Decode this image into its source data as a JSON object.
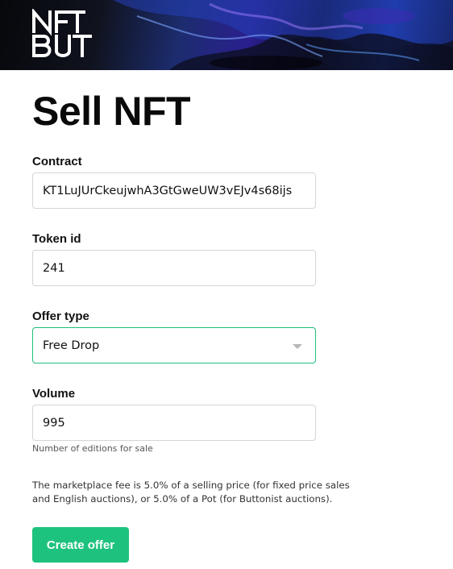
{
  "header": {
    "logo_icon": "nftbutton-logo-icon"
  },
  "page": {
    "title": "Sell NFT"
  },
  "form": {
    "contract": {
      "label": "Contract",
      "value": "KT1LuJUrCkeujwhA3GtGweUW3vEJv4s68ijs"
    },
    "token_id": {
      "label": "Token id",
      "value": "241"
    },
    "offer_type": {
      "label": "Offer type",
      "selected": "Free Drop",
      "icon": "chevron-down-icon"
    },
    "volume": {
      "label": "Volume",
      "value": "995",
      "hint": "Number of editions for sale"
    },
    "fee_line_1": "The marketplace fee is 5.0% of a selling price (for fixed price sales",
    "fee_line_2": "and English auctions), or 5.0% of a Pot (for Buttonist auctions).",
    "submit_label": "Create offer"
  },
  "colors": {
    "accent": "#1ec27f",
    "border": "#d5d5d5",
    "text": "#111111"
  }
}
